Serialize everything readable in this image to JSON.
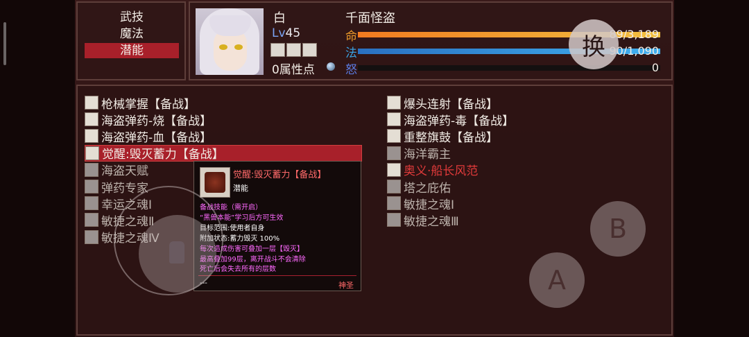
{
  "menu": {
    "items": [
      {
        "label": "武技",
        "selected": false
      },
      {
        "label": "魔法",
        "selected": false
      },
      {
        "label": "潜能",
        "selected": true
      }
    ]
  },
  "character": {
    "name": "白",
    "title": "千面怪盗",
    "level_prefix": "Lv",
    "level": "45",
    "attribute_points": "0属性点",
    "stats": {
      "hp": {
        "label": "命",
        "value": "89/3,189",
        "fill_fraction": 1.0,
        "color": "#f0a030"
      },
      "mp": {
        "label": "法",
        "value": "90/1,090",
        "fill_fraction": 1.0,
        "color": "#3aa0e0"
      },
      "rage": {
        "label": "怒",
        "value": "0",
        "fill_fraction": 0.0,
        "color": "#4a6ad0"
      }
    }
  },
  "swap_button": {
    "label": "换"
  },
  "skills": {
    "left": [
      {
        "label": "枪械掌握【备战】",
        "style": "normal",
        "icon": "gun-icon"
      },
      {
        "label": "海盗弹药-烧【备战】",
        "style": "normal",
        "icon": "ammo-burn-icon"
      },
      {
        "label": "海盗弹药-血【备战】",
        "style": "normal",
        "icon": "ammo-blood-icon"
      },
      {
        "label": "觉醒:毁灭蓄力【备战】",
        "style": "selected",
        "icon": "awaken-icon"
      },
      {
        "label": "海盗天赋",
        "style": "dim",
        "icon": "skull-icon"
      },
      {
        "label": "弹药专家",
        "style": "dim",
        "icon": "ammo-icon"
      },
      {
        "label": "幸运之魂Ⅰ",
        "style": "dim",
        "icon": "soul-icon"
      },
      {
        "label": "敏捷之魂Ⅱ",
        "style": "dim",
        "icon": "soul-icon"
      },
      {
        "label": "敏捷之魂Ⅳ",
        "style": "dim",
        "icon": "soul-icon"
      }
    ],
    "right": [
      {
        "label": "爆头连射【备战】",
        "style": "normal",
        "icon": "crosshair-icon"
      },
      {
        "label": "海盗弹药-毒【备战】",
        "style": "normal",
        "icon": "ammo-poison-icon"
      },
      {
        "label": "重整旗鼓【备战】",
        "style": "normal",
        "icon": "flag-icon"
      },
      {
        "label": "海洋霸主",
        "style": "dim",
        "icon": "wave-icon"
      },
      {
        "label": "奥义·船长风范",
        "style": "red",
        "icon": "captain-icon"
      },
      {
        "label": "塔之庇佑",
        "style": "dim",
        "icon": "tower-icon"
      },
      {
        "label": "敏捷之魂Ⅰ",
        "style": "dim",
        "icon": "soul-icon"
      },
      {
        "label": "敏捷之魂Ⅲ",
        "style": "dim",
        "icon": "soul-icon"
      }
    ]
  },
  "tooltip": {
    "title": "觉醒:毁灭蓄力【备战】",
    "type": "潜能",
    "lines": [
      "备战技能（需开启）",
      "“黑兽本能”学习后方可生效",
      "目标范围:使用者自身",
      "附加状态:蓄力毁灭 100%",
      "每次造成伤害可叠加一层【毁灭】",
      "最高叠加99层，离开战斗不会清除",
      "死亡后会失去所有的层数"
    ],
    "footer_left": "---",
    "footer_right": "神圣"
  },
  "controls": {
    "b_label": "B",
    "a_label": "A"
  }
}
